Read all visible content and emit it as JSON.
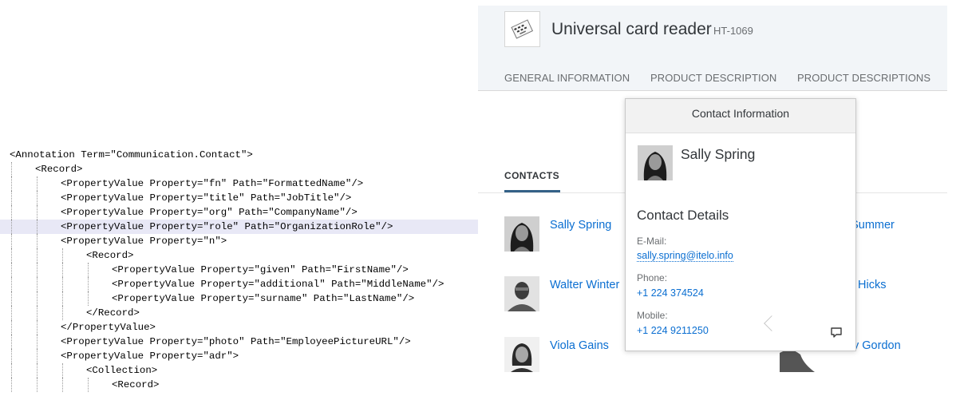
{
  "editor": {
    "lines": [
      {
        "indent": 0,
        "text": "<Annotation Term=\"Communication.Contact\">"
      },
      {
        "indent": 1,
        "text": "<Record>"
      },
      {
        "indent": 2,
        "text": "<PropertyValue Property=\"fn\" Path=\"FormattedName\"/>"
      },
      {
        "indent": 2,
        "text": "<PropertyValue Property=\"title\" Path=\"JobTitle\"/>"
      },
      {
        "indent": 2,
        "text": "<PropertyValue Property=\"org\" Path=\"CompanyName\"/>"
      },
      {
        "indent": 2,
        "text": "<PropertyValue Property=\"role\" Path=\"OrganizationRole\"/>",
        "highlighted": true
      },
      {
        "indent": 2,
        "text": "<PropertyValue Property=\"n\">"
      },
      {
        "indent": 3,
        "text": "<Record>"
      },
      {
        "indent": 4,
        "text": "<PropertyValue Property=\"given\" Path=\"FirstName\"/>"
      },
      {
        "indent": 4,
        "text": "<PropertyValue Property=\"additional\" Path=\"MiddleName\"/>"
      },
      {
        "indent": 4,
        "text": "<PropertyValue Property=\"surname\" Path=\"LastName\"/>"
      },
      {
        "indent": 3,
        "text": "</Record>"
      },
      {
        "indent": 2,
        "text": "</PropertyValue>"
      },
      {
        "indent": 2,
        "text": "<PropertyValue Property=\"photo\" Path=\"EmployeePictureURL\"/>"
      },
      {
        "indent": 2,
        "text": "<PropertyValue Property=\"adr\">"
      },
      {
        "indent": 3,
        "text": "<Collection>"
      },
      {
        "indent": 4,
        "text": "<Record>"
      }
    ]
  },
  "product": {
    "title": "Universal card reader",
    "id": "HT-1069",
    "image_icon": "card-reader-product-image"
  },
  "tabs": [
    {
      "label": "GENERAL INFORMATION"
    },
    {
      "label": "PRODUCT DESCRIPTION"
    },
    {
      "label": "PRODUCT DESCRIPTIONS"
    }
  ],
  "contacts": {
    "heading": "CONTACTS",
    "items": [
      {
        "name": "Sally Spring"
      },
      {
        "name": "n Summer"
      },
      {
        "name": "Walter Winter"
      },
      {
        "name": "Hicks"
      },
      {
        "name": "Viola Gains"
      },
      {
        "name": "y Gordon"
      }
    ]
  },
  "popover": {
    "title": "Contact Information",
    "name": "Sally Spring",
    "details_heading": "Contact Details",
    "email_label": "E-Mail:",
    "email": "sally.spring@itelo.info",
    "phone_label": "Phone:",
    "phone": "+1 224 374524",
    "mobile_label": "Mobile:",
    "mobile": "+1 224 9211250",
    "action_icon": "chat-icon"
  },
  "colors": {
    "link": "#0a6ed1",
    "header_bg": "#f2f5f8",
    "tab_underline": "#346187",
    "code_highlight": "#e8e8f6"
  }
}
